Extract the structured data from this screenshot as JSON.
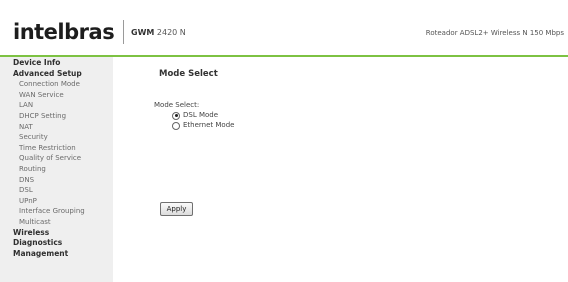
{
  "header": {
    "logo_text": "intelbras",
    "model_prefix": "GWM",
    "model_suffix": " 2420 N",
    "product_description": "Roteador ADSL2+ Wireless N 150 Mbps",
    "accent_color": "#7dc242"
  },
  "sidebar": {
    "items": [
      {
        "label": "Device Info",
        "level": "top"
      },
      {
        "label": "Advanced Setup",
        "level": "top"
      },
      {
        "label": "Connection Mode",
        "level": "sub"
      },
      {
        "label": "WAN Service",
        "level": "sub"
      },
      {
        "label": "LAN",
        "level": "sub"
      },
      {
        "label": "DHCP Setting",
        "level": "sub"
      },
      {
        "label": "NAT",
        "level": "sub"
      },
      {
        "label": "Security",
        "level": "sub"
      },
      {
        "label": "Time Restriction",
        "level": "sub"
      },
      {
        "label": "Quality of Service",
        "level": "sub"
      },
      {
        "label": "Routing",
        "level": "sub"
      },
      {
        "label": "DNS",
        "level": "sub"
      },
      {
        "label": "DSL",
        "level": "sub"
      },
      {
        "label": "UPnP",
        "level": "sub"
      },
      {
        "label": "Interface Grouping",
        "level": "sub"
      },
      {
        "label": "Multicast",
        "level": "sub"
      },
      {
        "label": "Wireless",
        "level": "top"
      },
      {
        "label": "Diagnostics",
        "level": "top"
      },
      {
        "label": "Management",
        "level": "top"
      }
    ]
  },
  "main": {
    "title": "Mode Select",
    "field_label": "Mode Select:",
    "options": [
      {
        "label": "DSL Mode",
        "selected": true
      },
      {
        "label": "Ethernet Mode",
        "selected": false
      }
    ],
    "apply_label": "Apply"
  }
}
